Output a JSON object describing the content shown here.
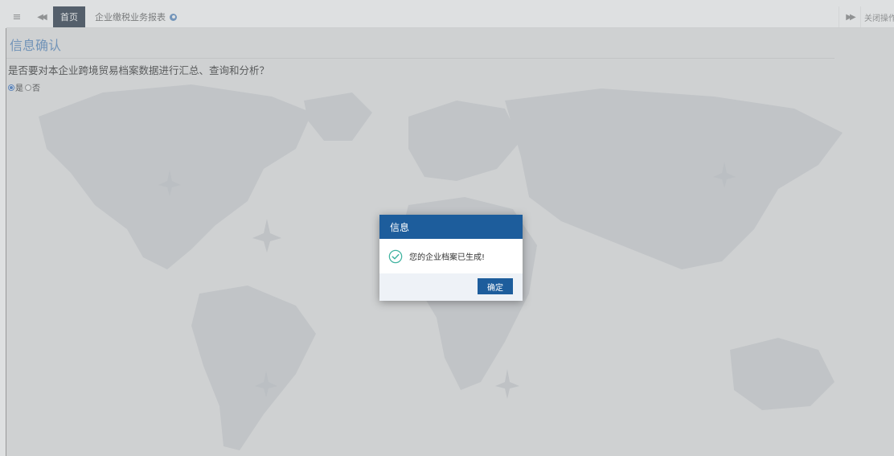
{
  "topbar": {
    "menu_icon": "≡",
    "prev_icon": "◀◀",
    "home_tab_label": "首页",
    "active_tab_label": "企业缴税业务报表",
    "next_icon": "▶▶",
    "close_ops_label": "关闭操作▾"
  },
  "page": {
    "title": "信息确认",
    "question": "是否要对本企业跨境贸易档案数据进行汇总、查询和分析？",
    "radio_options": [
      "是",
      "否"
    ],
    "radio_selected": "是"
  },
  "dialog": {
    "title": "信息",
    "message": "您的企业档案已生成!",
    "ok_label": "确定",
    "icon": "check-circle-icon"
  },
  "colors": {
    "accent": "#1d5d9c",
    "title_blue": "#5a8ac0",
    "home_tab": "#2b3a4a"
  }
}
